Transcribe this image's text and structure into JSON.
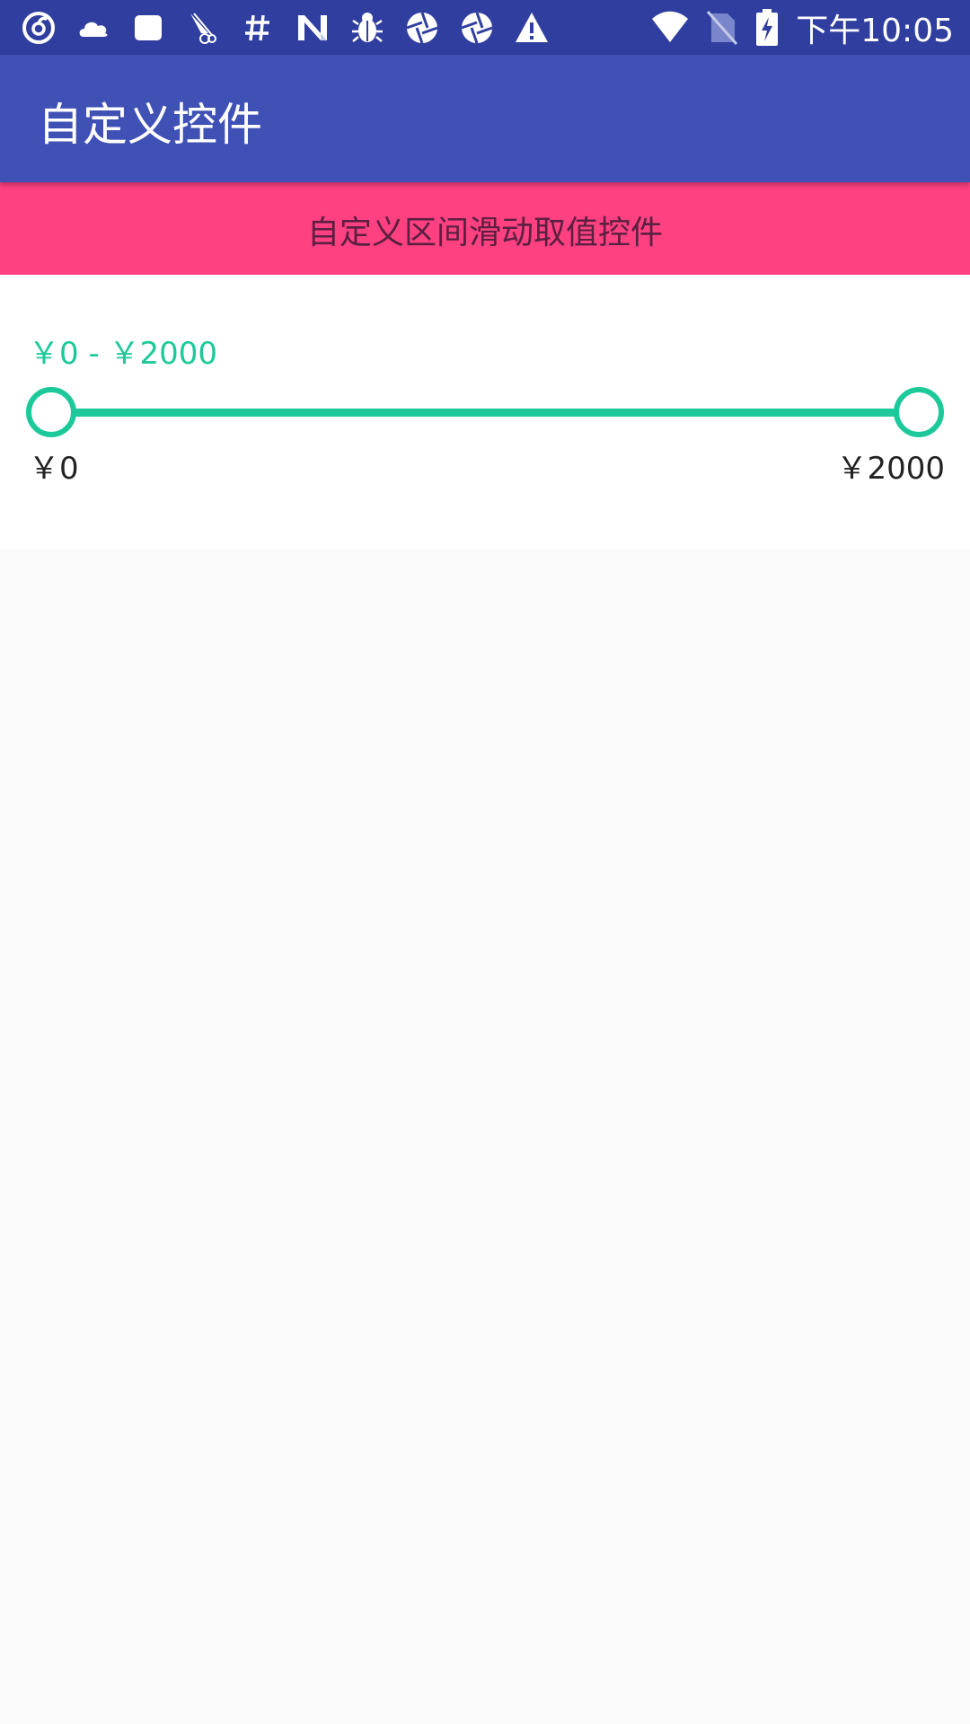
{
  "status_bar": {
    "time": "下午10:05",
    "left_icons": [
      "netease-music-icon",
      "cloud-icon",
      "square-app-icon",
      "bird-icon",
      "hash-icon",
      "n-logo-icon",
      "bug-icon",
      "aperture-icon",
      "aperture-icon",
      "warning-icon"
    ],
    "right_icons": [
      "wifi-icon",
      "no-sim-icon",
      "battery-charging-icon"
    ],
    "background": "#303f9f"
  },
  "app_bar": {
    "title": "自定义控件",
    "background": "#3f51b5"
  },
  "banner": {
    "text": "自定义区间滑动取值控件",
    "background": "#ff4081"
  },
  "range_slider": {
    "readout": "￥0 - ￥2000",
    "min_label": "￥0",
    "max_label": "￥2000",
    "min_value": 0,
    "max_value": 2000,
    "selected_low": 0,
    "selected_high": 2000,
    "accent_color": "#1dc99a"
  }
}
